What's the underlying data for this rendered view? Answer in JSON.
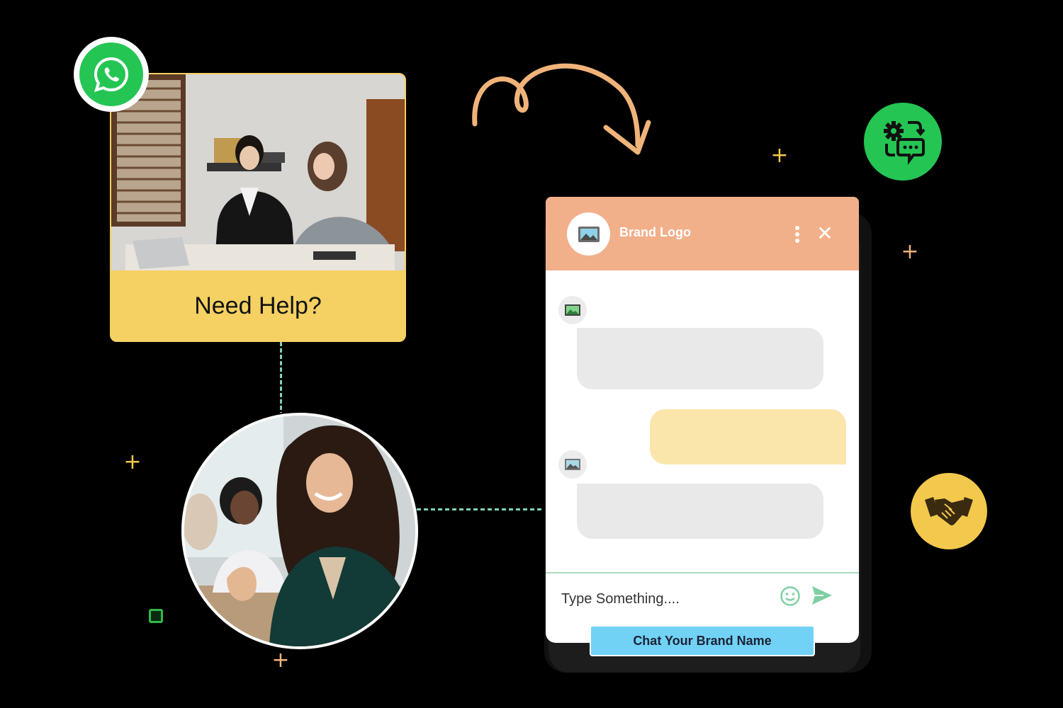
{
  "help_card": {
    "label": "Need Help?"
  },
  "widget": {
    "brand_name": "Brand Logo",
    "input_placeholder": "Type Something....",
    "cta_label": "Chat Your Brand Name"
  },
  "colors": {
    "header": "#f2b08a",
    "accent_green": "#25c554",
    "help_yellow": "#f5d063",
    "cta_blue": "#71d2f6",
    "handshake_yellow": "#f2c94c"
  },
  "icons": {
    "whatsapp": "whatsapp-icon",
    "automation": "gear-chat-icon",
    "partnership": "handshake-icon",
    "brand_logo": "image-placeholder-icon",
    "emoji": "smile-icon",
    "send": "send-icon",
    "menu": "kebab-menu-icon",
    "close": "close-icon"
  }
}
